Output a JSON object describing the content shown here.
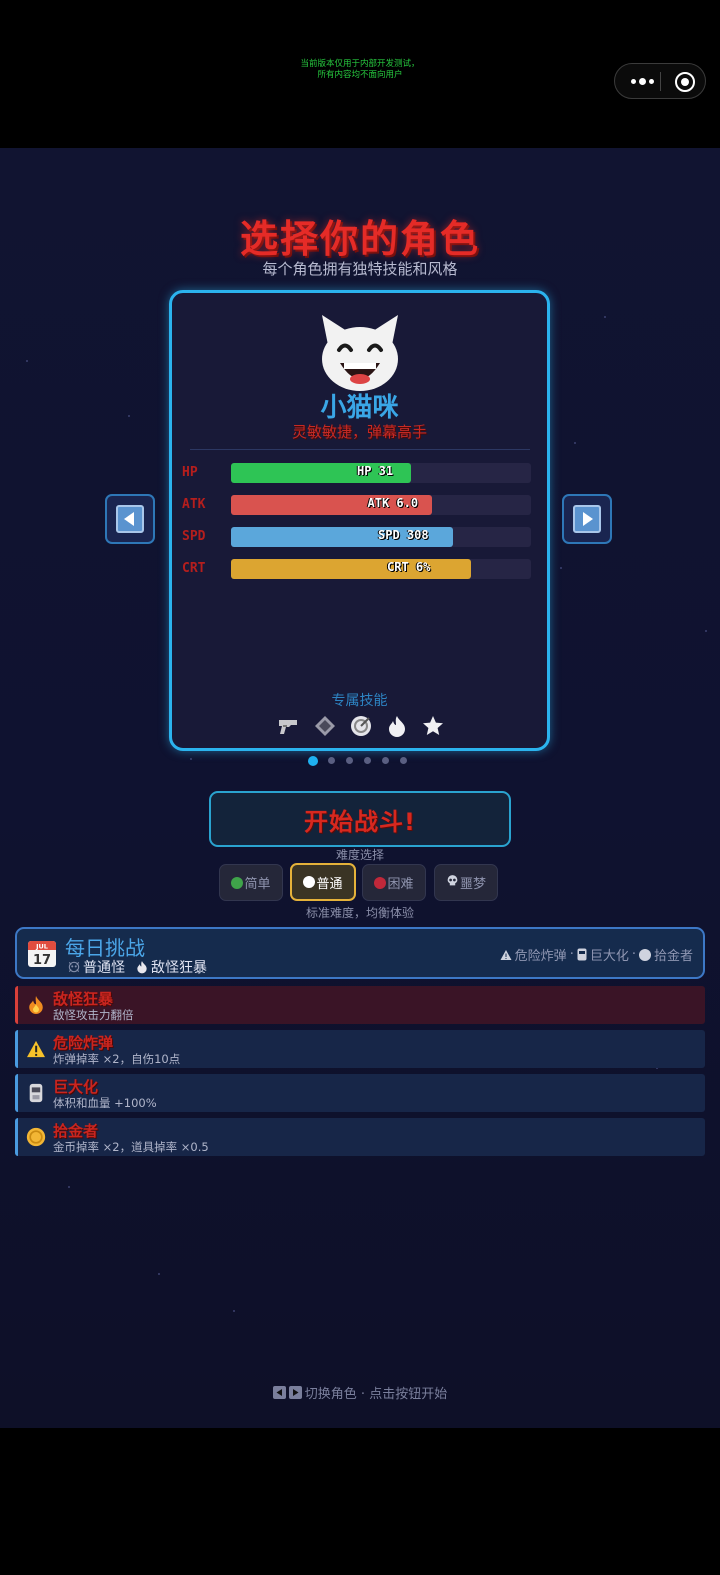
{
  "system": {
    "dev_notice_line1": "当前版本仅用于内部开发测试，",
    "dev_notice_line2": "所有内容均不面向用户"
  },
  "header": {
    "title": "选择你的角色",
    "subtitle": "每个角色拥有独特技能和风格"
  },
  "character": {
    "emoji_icon": "grinning-cat-icon",
    "name": "小猫咪",
    "description": "灵敏敏捷，弹幕高手",
    "stats": [
      {
        "label": "HP",
        "text": "HP 31",
        "fill": 0.6,
        "color": "#2ec455"
      },
      {
        "label": "ATK",
        "text": "ATK 6.0",
        "fill": 0.67,
        "color": "#d9534f"
      },
      {
        "label": "SPD",
        "text": "SPD 308",
        "fill": 0.74,
        "color": "#5ba7db"
      },
      {
        "label": "CRT",
        "text": "CRT 6%",
        "fill": 0.8,
        "color": "#dca531"
      }
    ],
    "skills_label": "专属技能",
    "skills": [
      "pistol-icon",
      "diamond-icon",
      "target-icon",
      "flame-icon",
      "star-icon"
    ]
  },
  "carousel": {
    "count": 6,
    "active_index": 0
  },
  "actions": {
    "start_label": "开始战斗!",
    "difficulty_label": "难度选择",
    "difficulties": [
      {
        "label": "简单",
        "color": "#3fa34a"
      },
      {
        "label": "普通",
        "color": "#ffffff"
      },
      {
        "label": "困难",
        "color": "#c0283a"
      },
      {
        "label": "噩梦",
        "color": "#cfd3df"
      }
    ],
    "selected_difficulty": 1,
    "difficulty_desc": "标准难度，均衡体验"
  },
  "daily": {
    "title": "每日挑战",
    "calendar_month": "JUL",
    "calendar_day": "17",
    "enemy_type": "普通怪",
    "enemy_mod": "敌怪狂暴",
    "mods": [
      "危险炸弹",
      "巨大化",
      "拾金者"
    ],
    "separator": "·"
  },
  "modifiers": [
    {
      "name": "敌怪狂暴",
      "desc": "敌怪攻击力翻倍",
      "icon": "fire-icon",
      "accent": "#d8403a",
      "bg": "#3a1426"
    },
    {
      "name": "危险炸弹",
      "desc": "炸弹掉率 ×2，自伤10点",
      "icon": "warning-icon",
      "accent": "#4a9be0",
      "bg": "#172648"
    },
    {
      "name": "巨大化",
      "desc": "体积和血量 +100%",
      "icon": "robot-icon",
      "accent": "#4a9be0",
      "bg": "#172648"
    },
    {
      "name": "拾金者",
      "desc": "金币掉率 ×2，道具掉率 ×0.5",
      "icon": "coin-icon",
      "accent": "#4a9be0",
      "bg": "#172648"
    }
  ],
  "footer": {
    "hint": "切换角色 · 点击按钮开始"
  }
}
